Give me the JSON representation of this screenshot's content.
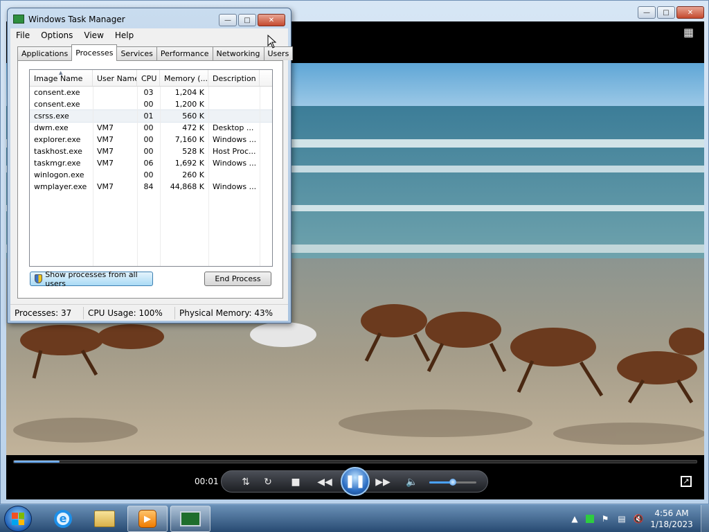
{
  "task_manager": {
    "title": "Windows Task Manager",
    "menu": [
      "File",
      "Options",
      "View",
      "Help"
    ],
    "tabs": [
      "Applications",
      "Processes",
      "Services",
      "Performance",
      "Networking",
      "Users"
    ],
    "active_tab": "Processes",
    "columns": [
      "Image Name",
      "User Name",
      "CPU",
      "Memory (...",
      "Description"
    ],
    "processes": [
      {
        "name": "consent.exe",
        "user": "",
        "cpu": "03",
        "mem": "1,204 K",
        "desc": ""
      },
      {
        "name": "consent.exe",
        "user": "",
        "cpu": "00",
        "mem": "1,200 K",
        "desc": ""
      },
      {
        "name": "csrss.exe",
        "user": "",
        "cpu": "01",
        "mem": "560 K",
        "desc": ""
      },
      {
        "name": "dwm.exe",
        "user": "VM7",
        "cpu": "00",
        "mem": "472 K",
        "desc": "Desktop ..."
      },
      {
        "name": "explorer.exe",
        "user": "VM7",
        "cpu": "00",
        "mem": "7,160 K",
        "desc": "Windows ..."
      },
      {
        "name": "taskhost.exe",
        "user": "VM7",
        "cpu": "00",
        "mem": "528 K",
        "desc": "Host Proc..."
      },
      {
        "name": "taskmgr.exe",
        "user": "VM7",
        "cpu": "06",
        "mem": "1,692 K",
        "desc": "Windows ..."
      },
      {
        "name": "winlogon.exe",
        "user": "",
        "cpu": "00",
        "mem": "260 K",
        "desc": ""
      },
      {
        "name": "wmplayer.exe",
        "user": "VM7",
        "cpu": "84",
        "mem": "44,868 K",
        "desc": "Windows ..."
      }
    ],
    "show_all_label": "Show processes from all users",
    "end_process_label": "End Process",
    "status": {
      "processes": "Processes: 37",
      "cpu": "CPU Usage: 100%",
      "memory": "Physical Memory: 43%"
    }
  },
  "media_player": {
    "time": "00:01",
    "seek_progress": 0.067,
    "volume_level": 0.5,
    "accent": "#3b7fd0"
  },
  "taskbar": {
    "time": "4:56 AM",
    "date": "1/18/2023"
  }
}
